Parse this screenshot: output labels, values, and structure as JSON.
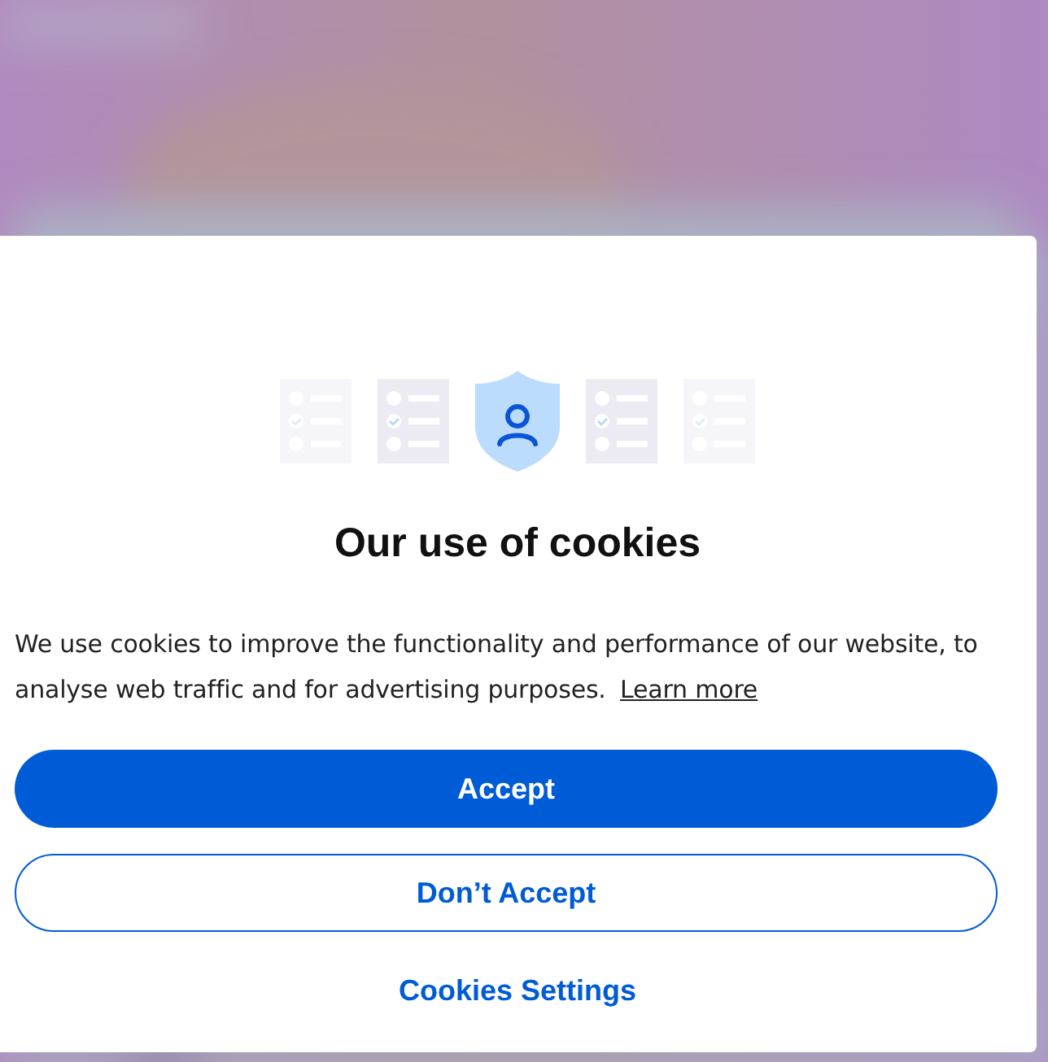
{
  "dialog": {
    "title": "Our use of cookies",
    "body": "We use cookies to improve the functionality and performance of our website, to analyse web traffic and for advertising purposes.",
    "link": "Learn more",
    "buttons": [
      {
        "kind": "primary",
        "label": "Accept"
      },
      {
        "kind": "outline",
        "label": "Don’t Accept"
      },
      {
        "kind": "text",
        "label": "Cookies Settings"
      }
    ]
  }
}
